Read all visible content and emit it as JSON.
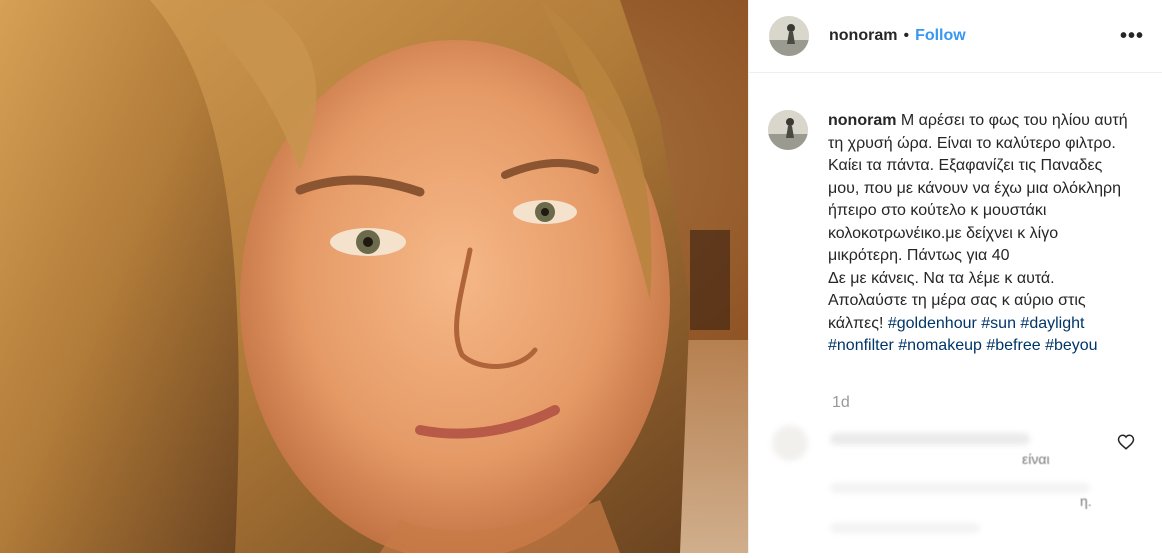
{
  "post": {
    "username": "nonoram",
    "separator": "•",
    "follow_label": "Follow",
    "more_icon": "more-options-icon"
  },
  "caption": {
    "username": "nonoram",
    "text": "Μ αρέσει το φως του ηλίου αυτή τη χρυσή ώρα. Είναι το καλύτερο φιλτρο. Καίει τα πάντα. Εξαφανίζει τις Παναδες μου, που με κάνουν να έχω μια ολόκληρη ήπειρο στο κούτελο κ μουστάκι κολοκοτρωνέικο.με δείχνει κ λίγο μικρότερη. Πάντως για 40",
    "text2": "Δε με κάνεις. Να τα λέμε κ αυτά. Απολαύστε τη μέρα σας κ αύριο στις κάλπες!",
    "hashtags": [
      "#goldenhour",
      "#sun",
      "#daylight",
      "#nonfilter",
      "#nomakeup",
      "#befree",
      "#beyou"
    ]
  },
  "timestamp": "1d",
  "comment_preview": {
    "text_fragment": "είναι",
    "text_fragment2": "η."
  },
  "colors": {
    "link": "#3897f0",
    "hashtag": "#003569",
    "muted": "#999999",
    "text": "#262626"
  }
}
